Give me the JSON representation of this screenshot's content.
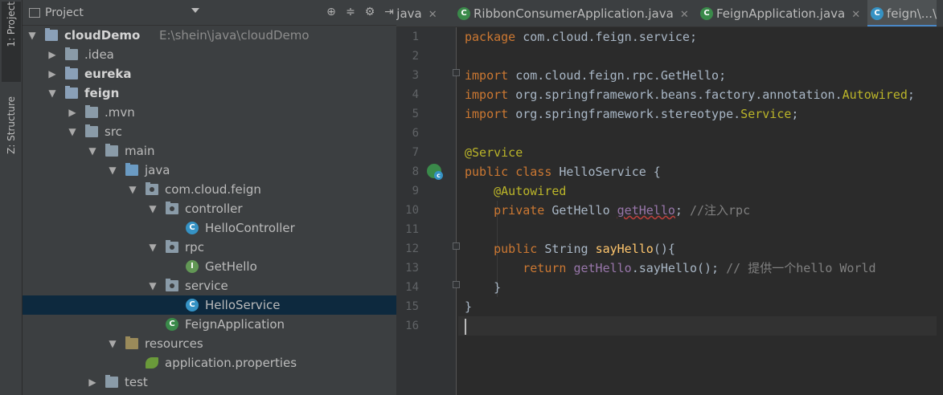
{
  "sidebar_strip": {
    "project_label": "1: Project",
    "structure_label": "Z: Structure"
  },
  "project_panel": {
    "title": "Project",
    "tree": [
      {
        "label": "cloudDemo",
        "path": "E:\\shein\\java\\cloudDemo",
        "depth": 0,
        "arrow": "▼",
        "icon": "module-folder-icon",
        "bold": true
      },
      {
        "label": ".idea",
        "depth": 1,
        "arrow": "▶",
        "icon": "folder-icon"
      },
      {
        "label": "eureka",
        "depth": 1,
        "arrow": "▶",
        "icon": "module-folder-icon",
        "bold": true
      },
      {
        "label": "feign",
        "depth": 1,
        "arrow": "▼",
        "icon": "module-folder-icon",
        "bold": true
      },
      {
        "label": ".mvn",
        "depth": 2,
        "arrow": "▶",
        "icon": "folder-icon"
      },
      {
        "label": "src",
        "depth": 2,
        "arrow": "▼",
        "icon": "folder-icon"
      },
      {
        "label": "main",
        "depth": 3,
        "arrow": "▼",
        "icon": "folder-icon"
      },
      {
        "label": "java",
        "depth": 4,
        "arrow": "▼",
        "icon": "source-folder-icon"
      },
      {
        "label": "com.cloud.feign",
        "depth": 5,
        "arrow": "▼",
        "icon": "package-icon"
      },
      {
        "label": "controller",
        "depth": 6,
        "arrow": "▼",
        "icon": "package-icon"
      },
      {
        "label": "HelloController",
        "depth": 7,
        "arrow": "",
        "icon": "class-icon"
      },
      {
        "label": "rpc",
        "depth": 6,
        "arrow": "▼",
        "icon": "package-icon"
      },
      {
        "label": "GetHello",
        "depth": 7,
        "arrow": "",
        "icon": "interface-icon"
      },
      {
        "label": "service",
        "depth": 6,
        "arrow": "▼",
        "icon": "package-icon"
      },
      {
        "label": "HelloService",
        "depth": 7,
        "arrow": "",
        "icon": "class-icon",
        "selected": true
      },
      {
        "label": "FeignApplication",
        "depth": 6,
        "arrow": "",
        "icon": "spring-class-icon"
      },
      {
        "label": "resources",
        "depth": 4,
        "arrow": "▼",
        "icon": "resources-folder-icon"
      },
      {
        "label": "application.properties",
        "depth": 5,
        "arrow": "",
        "icon": "spring-properties-icon"
      },
      {
        "label": "test",
        "depth": 3,
        "arrow": "▶",
        "icon": "folder-icon"
      }
    ]
  },
  "editor": {
    "tabs": [
      {
        "label": "n.java",
        "close": "✕",
        "icon": ""
      },
      {
        "label": "RibbonConsumerApplication.java",
        "close": "✕",
        "icon": "spring-class-icon"
      },
      {
        "label": "FeignApplication.java",
        "close": "✕",
        "icon": "spring-class-icon"
      },
      {
        "label": "feign\\...\\",
        "close": "",
        "icon": "class-icon",
        "active": true
      }
    ],
    "line_numbers": [
      "1",
      "2",
      "3",
      "4",
      "5",
      "6",
      "7",
      "8",
      "9",
      "10",
      "11",
      "12",
      "13",
      "14",
      "15",
      "16"
    ]
  },
  "colors": {
    "keyword": "#cc7832",
    "annotation": "#bbb529",
    "method": "#ffc66d",
    "field": "#9876aa",
    "comment": "#808080",
    "selection": "#0d293e"
  }
}
